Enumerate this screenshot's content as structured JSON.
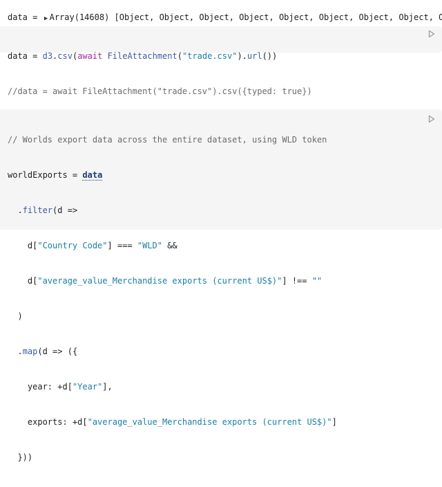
{
  "output": {
    "name": "data",
    "eq": "=",
    "summary": "Array(14608)",
    "preview": "[Object, Object, Object, Object, Object, Object, Object, Object, Object, Ob"
  },
  "cell1": {
    "line1": {
      "name": "data",
      "eq": " = ",
      "obj": "d3",
      "dot": ".",
      "fn": "csv",
      "open": "(",
      "await": "await",
      "sp": " ",
      "attach": "FileAttachment",
      "p1": "(",
      "file": "\"trade.csv\"",
      "p2": ").",
      "url": "url",
      "end": "())"
    },
    "line2": "//data = await FileAttachment(\"trade.csv\").csv({typed: true})"
  },
  "cell2": {
    "comment": "// Worlds export data across the entire dataset, using WLD token",
    "decl_name": "worldExports",
    "decl_eq": " = ",
    "decl_ref": "data",
    "l3_indent": "  .",
    "l3_fn": "filter",
    "l3_rest": "(d =>",
    "l4_a": "    d[",
    "l4_s1": "\"Country Code\"",
    "l4_b": "] === ",
    "l4_s2": "\"WLD\"",
    "l4_c": " &&",
    "l5_a": "    d[",
    "l5_s1": "\"average_value_Merchandise exports (current US$)\"",
    "l5_b": "] !== ",
    "l5_s2": "\"\"",
    "l6": "  )",
    "l7_indent": "  .",
    "l7_fn": "map",
    "l7_rest": "(d => ({",
    "l8_a": "    year: +d[",
    "l8_s": "\"Year\"",
    "l8_b": "],",
    "l9_a": "    exports: +d[",
    "l9_s": "\"average_value_Merchandise exports (current US$)\"",
    "l9_b": "]",
    "l10": "  }))"
  },
  "icons": {
    "run": "play-icon",
    "caret": "caret-right-icon"
  }
}
